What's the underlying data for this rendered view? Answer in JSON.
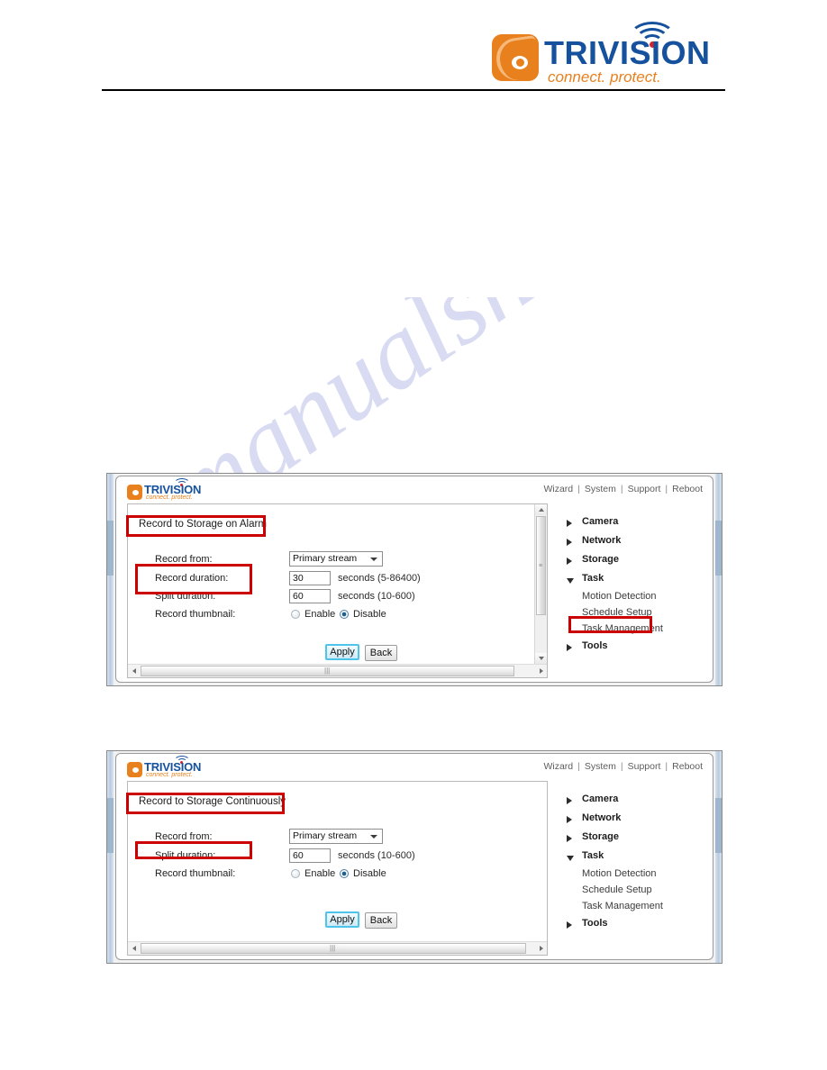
{
  "header": {
    "brand": {
      "wordmark": "TRIVISION",
      "tagline": "connect. protect."
    }
  },
  "watermark": {
    "text": "manualshive.com"
  },
  "panels": [
    {
      "id": "panel-alarm",
      "brand": {
        "wordmark": "TRIVISION",
        "tagline": "connect. protect."
      },
      "topnav": {
        "wizard": "Wizard",
        "system": "System",
        "support": "Support",
        "reboot": "Reboot",
        "separator": "|"
      },
      "form": {
        "title": "Record to Storage on Alarm",
        "rows": [
          {
            "label": "Record from:",
            "control": "select",
            "value": "Primary stream",
            "units": ""
          },
          {
            "label": "Record duration:",
            "control": "text",
            "value": "30",
            "units": "seconds (5-86400)"
          },
          {
            "label": "Split duration:",
            "control": "text",
            "value": "60",
            "units": "seconds (10-600)"
          },
          {
            "label": "Record thumbnail:",
            "control": "radio",
            "value": "Disable",
            "units": ""
          }
        ],
        "radio_options": [
          "Enable",
          "Disable"
        ],
        "buttons": {
          "apply": "Apply",
          "back": "Back"
        }
      },
      "menu": [
        {
          "label": "Camera",
          "state": "collapsed",
          "children": []
        },
        {
          "label": "Network",
          "state": "collapsed",
          "children": []
        },
        {
          "label": "Storage",
          "state": "collapsed",
          "children": []
        },
        {
          "label": "Task",
          "state": "expanded",
          "children": [
            "Motion Detection",
            "Schedule Setup",
            "Task Management"
          ]
        },
        {
          "label": "Tools",
          "state": "collapsed",
          "children": []
        }
      ],
      "highlights": [
        "Record to Storage on Alarm",
        "Record duration: / Split duration:",
        "Task Management"
      ]
    },
    {
      "id": "panel-continuous",
      "brand": {
        "wordmark": "TRIVISION",
        "tagline": "connect. protect."
      },
      "topnav": {
        "wizard": "Wizard",
        "system": "System",
        "support": "Support",
        "reboot": "Reboot",
        "separator": "|"
      },
      "form": {
        "title": "Record to Storage Continuously",
        "rows": [
          {
            "label": "Record from:",
            "control": "select",
            "value": "Primary stream",
            "units": ""
          },
          {
            "label": "Split duration:",
            "control": "text",
            "value": "60",
            "units": "seconds (10-600)"
          },
          {
            "label": "Record thumbnail:",
            "control": "radio",
            "value": "Disable",
            "units": ""
          }
        ],
        "radio_options": [
          "Enable",
          "Disable"
        ],
        "buttons": {
          "apply": "Apply",
          "back": "Back"
        }
      },
      "menu": [
        {
          "label": "Camera",
          "state": "collapsed",
          "children": []
        },
        {
          "label": "Network",
          "state": "collapsed",
          "children": []
        },
        {
          "label": "Storage",
          "state": "collapsed",
          "children": []
        },
        {
          "label": "Task",
          "state": "expanded",
          "children": [
            "Motion Detection",
            "Schedule Setup",
            "Task Management"
          ]
        },
        {
          "label": "Tools",
          "state": "collapsed",
          "children": []
        }
      ],
      "highlights": [
        "Record to Storage Continuously",
        "Split duration:"
      ]
    }
  ],
  "colors": {
    "brand_blue": "#16519E",
    "brand_orange": "#E8801E",
    "annotation_red": "#CC0000",
    "focus_cyan": "#4FC4EA",
    "watermark_blue": "#B9BFE8"
  }
}
